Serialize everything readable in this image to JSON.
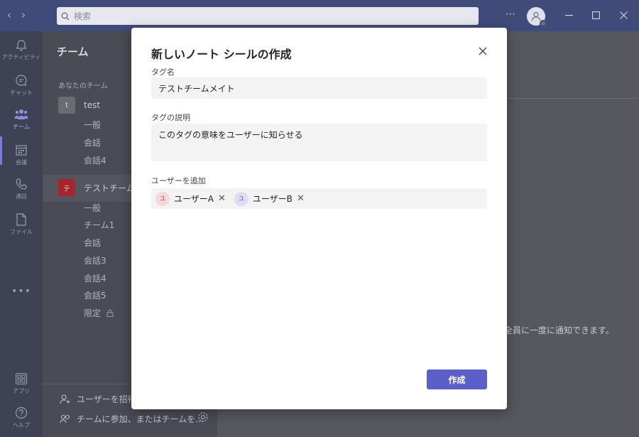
{
  "titlebar": {
    "search_placeholder": "検索",
    "more_label": "⋯"
  },
  "rail": {
    "items": [
      {
        "label": "アクティビティ",
        "icon": "bell-icon"
      },
      {
        "label": "チャット",
        "icon": "chat-icon"
      },
      {
        "label": "チーム",
        "icon": "teams-icon"
      },
      {
        "label": "会議",
        "icon": "calendar-icon"
      },
      {
        "label": "通話",
        "icon": "phone-icon"
      },
      {
        "label": "ファイル",
        "icon": "file-icon"
      }
    ],
    "more": "•••",
    "apps_label": "アプリ",
    "help_label": "ヘルプ"
  },
  "teampanel": {
    "title": "チーム",
    "section_label": "あなたのチーム",
    "teams": [
      {
        "name": "test",
        "avatar": "t",
        "color": "#6b6c72",
        "channels": [
          "一般",
          "会話",
          "会話4"
        ]
      },
      {
        "name": "テストチーム",
        "avatar": "テ",
        "color": "#a4262c",
        "channels": [
          "一般",
          "チーム1",
          "会話",
          "会話3",
          "会話4",
          "会話5",
          "限定"
        ]
      }
    ],
    "footer": {
      "invite": "ユーザーを招待",
      "join": "チームに参加、またはチームを..."
    }
  },
  "main": {
    "note": "全員に一度に通知できます。"
  },
  "dialog": {
    "title": "新しいノート シールの作成",
    "tag_name_label": "タグ名",
    "tag_name_value": "テストチームメイト",
    "tag_desc_label": "タグの説明",
    "tag_desc_value": "このタグの意味をユーザーに知らせる",
    "add_users_label": "ユーザーを追加",
    "users": [
      {
        "initial": "ユ",
        "name": "ユーザーA",
        "bg": "#f6d9db",
        "fg": "#a4373a"
      },
      {
        "initial": "ユ",
        "name": "ユーザーB",
        "bg": "#dcdcf2",
        "fg": "#4f52b2"
      }
    ],
    "create_label": "作成"
  },
  "colors": {
    "accent": "#5b5fc7",
    "titlebar": "#414b7a"
  }
}
